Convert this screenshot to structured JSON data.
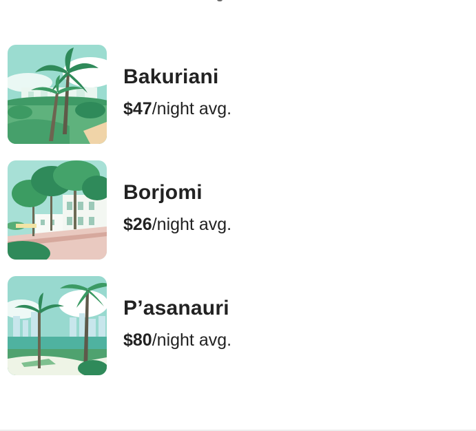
{
  "destinations": [
    {
      "name": "Bakuriani",
      "price": "$47",
      "unit": "/night avg.",
      "thumbnail_icon": "palm-park-illustration"
    },
    {
      "name": "Borjomi",
      "price": "$26",
      "unit": "/night avg.",
      "thumbnail_icon": "tree-lined-street-illustration"
    },
    {
      "name": "P’asanauri",
      "price": "$80",
      "unit": "/night avg.",
      "thumbnail_icon": "palm-city-skyline-illustration"
    }
  ],
  "colors": {
    "text": "#222222",
    "sky": "#8fd3c9",
    "foliage": "#2f8a5a",
    "lawn": "#5bb07a"
  }
}
